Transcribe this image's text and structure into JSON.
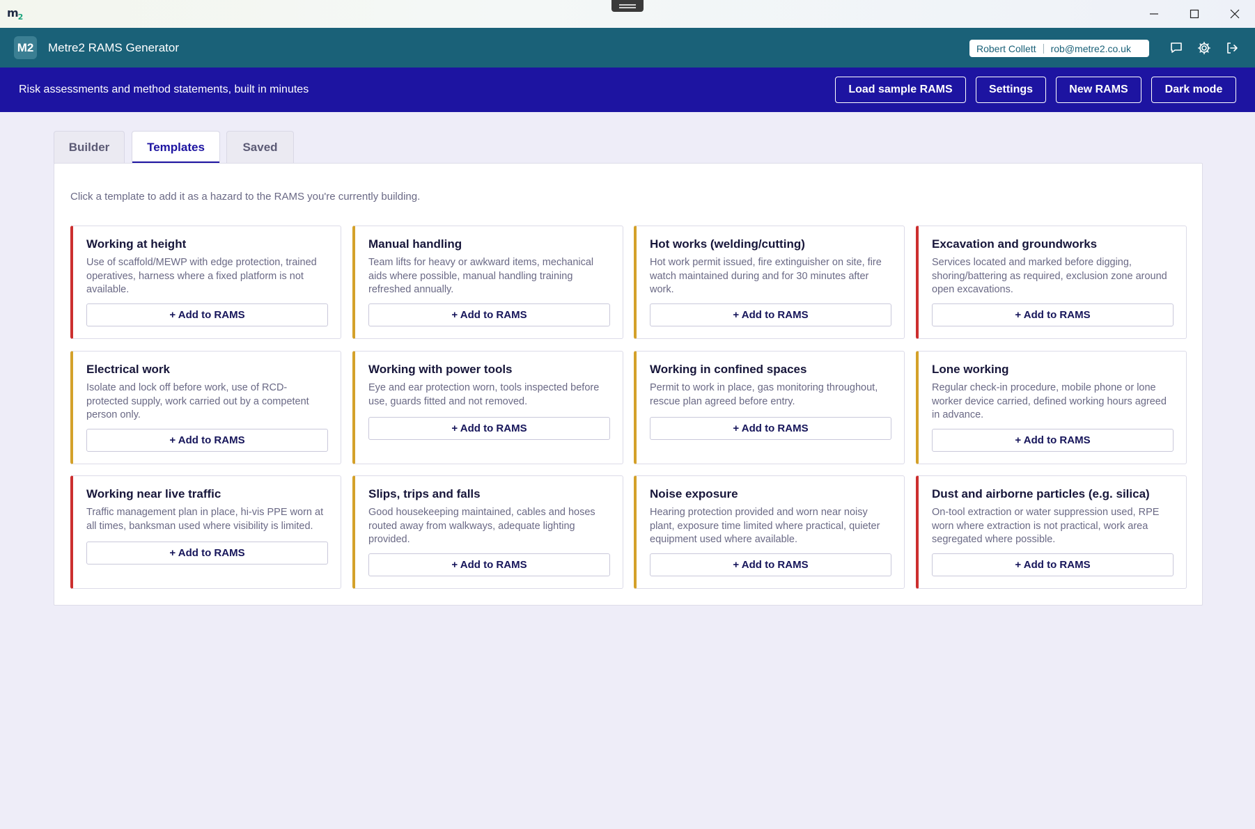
{
  "window": {
    "logo_text": "m",
    "logo_sub": "2"
  },
  "header": {
    "badge": "M2",
    "title": "Metre2 RAMS Generator",
    "user_name": "Robert Collett",
    "user_email": "rob@metre2.co.uk"
  },
  "banner": {
    "tagline": "Risk assessments and method statements, built in minutes",
    "buttons": [
      "Load sample RAMS",
      "Settings",
      "New RAMS",
      "Dark mode"
    ]
  },
  "tabs": [
    {
      "label": "Builder",
      "active": false
    },
    {
      "label": "Templates",
      "active": true
    },
    {
      "label": "Saved",
      "active": false
    }
  ],
  "templates": {
    "hint": "Click a template to add it as a hazard to the RAMS you're currently building.",
    "add_label": "+ Add to RAMS",
    "cards": [
      {
        "title": "Working at height",
        "desc": "Use of scaffold/MEWP with edge protection, trained operatives, harness where a fixed platform is not available.",
        "severity": "red"
      },
      {
        "title": "Manual handling",
        "desc": "Team lifts for heavy or awkward items, mechanical aids where possible, manual handling training refreshed annually.",
        "severity": "amber"
      },
      {
        "title": "Hot works (welding/cutting)",
        "desc": "Hot work permit issued, fire extinguisher on site, fire watch maintained during and for 30 minutes after work.",
        "severity": "amber"
      },
      {
        "title": "Excavation and groundworks",
        "desc": "Services located and marked before digging, shoring/battering as required, exclusion zone around open excavations.",
        "severity": "red"
      },
      {
        "title": "Electrical work",
        "desc": "Isolate and lock off before work, use of RCD-protected supply, work carried out by a competent person only.",
        "severity": "amber"
      },
      {
        "title": "Working with power tools",
        "desc": "Eye and ear protection worn, tools inspected before use, guards fitted and not removed.",
        "severity": "amber"
      },
      {
        "title": "Working in confined spaces",
        "desc": "Permit to work in place, gas monitoring throughout, rescue plan agreed before entry.",
        "severity": "amber"
      },
      {
        "title": "Lone working",
        "desc": "Regular check-in procedure, mobile phone or lone worker device carried, defined working hours agreed in advance.",
        "severity": "amber"
      },
      {
        "title": "Working near live traffic",
        "desc": "Traffic management plan in place, hi-vis PPE worn at all times, banksman used where visibility is limited.",
        "severity": "red"
      },
      {
        "title": "Slips, trips and falls",
        "desc": "Good housekeeping maintained, cables and hoses routed away from walkways, adequate lighting provided.",
        "severity": "amber"
      },
      {
        "title": "Noise exposure",
        "desc": "Hearing protection provided and worn near noisy plant, exposure time limited where practical, quieter equipment used where available.",
        "severity": "amber"
      },
      {
        "title": "Dust and airborne particles (e.g. silica)",
        "desc": "On-tool extraction or water suppression used, RPE worn where extraction is not practical, work area segregated where possible.",
        "severity": "red"
      }
    ]
  },
  "icons": {
    "minimize": "minimize-icon",
    "maximize": "maximize-icon",
    "close": "close-icon",
    "feedback": "chat-icon",
    "settings": "gear-icon",
    "logout": "logout-icon"
  },
  "colors": {
    "header": "#1a6178",
    "banner": "#1d14a1",
    "severity_red": "#cc2f2f",
    "severity_amber": "#d4a12a"
  }
}
